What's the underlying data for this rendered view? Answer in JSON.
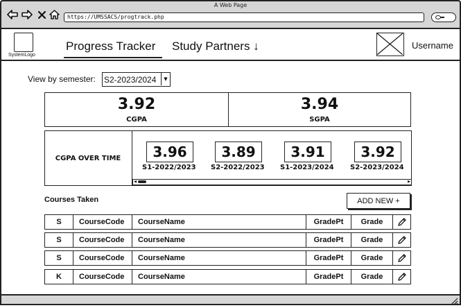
{
  "window": {
    "title": "A Web Page"
  },
  "browser": {
    "url": "https://UMSSACS/progtrack.php",
    "icons": [
      "back-arrow-icon",
      "forward-arrow-icon",
      "close-icon",
      "home-icon",
      "search-icon"
    ]
  },
  "header": {
    "logo_label": "SystemLogo",
    "tabs": [
      {
        "label": "Progress Tracker",
        "active": true
      },
      {
        "label": "Study Partners ↓",
        "active": false
      }
    ],
    "username": "Username"
  },
  "semester_filter": {
    "label": "View by semester:",
    "selected": "S2-2023/2024"
  },
  "summary": {
    "cgpa": {
      "value": "3.92",
      "label": "CGPA"
    },
    "sgpa": {
      "value": "3.94",
      "label": "SGPA"
    }
  },
  "trend": {
    "label": "CGPA OVER TIME",
    "items": [
      {
        "value": "3.96",
        "semester": "S1-2022/2023"
      },
      {
        "value": "3.89",
        "semester": "S2-2022/2023"
      },
      {
        "value": "3.91",
        "semester": "S1-2023/2024"
      },
      {
        "value": "3.92",
        "semester": "S2-2023/2024"
      }
    ]
  },
  "courses": {
    "title": "Courses Taken",
    "add_label": "ADD NEW +",
    "rows": [
      {
        "type": "S",
        "code": "CourseCode",
        "name": "CourseName",
        "gradept": "GradePt",
        "grade": "Grade"
      },
      {
        "type": "S",
        "code": "CourseCode",
        "name": "CourseName",
        "gradept": "GradePt",
        "grade": "Grade"
      },
      {
        "type": "S",
        "code": "CourseCode",
        "name": "CourseName",
        "gradept": "GradePt",
        "grade": "Grade"
      },
      {
        "type": "K",
        "code": "CourseCode",
        "name": "CourseName",
        "gradept": "GradePt",
        "grade": "Grade"
      }
    ]
  }
}
